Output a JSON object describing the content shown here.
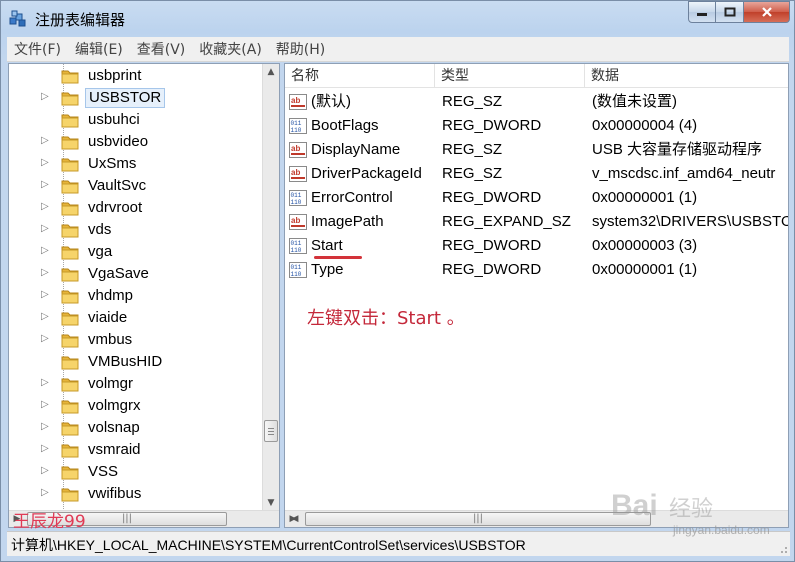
{
  "window": {
    "title": "注册表编辑器",
    "minimize_glyph": "▁",
    "maximize_glyph": "▢",
    "close_glyph": "✕"
  },
  "menu": [
    "文件(F)",
    "编辑(E)",
    "查看(V)",
    "收藏夹(A)",
    "帮助(H)"
  ],
  "tree": {
    "items": [
      {
        "label": "usbprint",
        "expandable": false
      },
      {
        "label": "USBSTOR",
        "expandable": true,
        "selected": true
      },
      {
        "label": "usbuhci",
        "expandable": false
      },
      {
        "label": "usbvideo",
        "expandable": true
      },
      {
        "label": "UxSms",
        "expandable": true
      },
      {
        "label": "VaultSvc",
        "expandable": true
      },
      {
        "label": "vdrvroot",
        "expandable": true
      },
      {
        "label": "vds",
        "expandable": true
      },
      {
        "label": "vga",
        "expandable": true
      },
      {
        "label": "VgaSave",
        "expandable": true
      },
      {
        "label": "vhdmp",
        "expandable": true
      },
      {
        "label": "viaide",
        "expandable": true
      },
      {
        "label": "vmbus",
        "expandable": true
      },
      {
        "label": "VMBusHID",
        "expandable": false
      },
      {
        "label": "volmgr",
        "expandable": true
      },
      {
        "label": "volmgrx",
        "expandable": true
      },
      {
        "label": "volsnap",
        "expandable": true
      },
      {
        "label": "vsmraid",
        "expandable": true
      },
      {
        "label": "VSS",
        "expandable": true
      },
      {
        "label": "vwifibus",
        "expandable": true
      }
    ]
  },
  "list": {
    "headers": {
      "name": "名称",
      "type": "类型",
      "data": "数据"
    },
    "rows": [
      {
        "icon": "string-value-icon",
        "name": "(默认)",
        "type": "REG_SZ",
        "data": "(数值未设置)"
      },
      {
        "icon": "binary-value-icon",
        "name": "BootFlags",
        "type": "REG_DWORD",
        "data": "0x00000004 (4)"
      },
      {
        "icon": "string-value-icon",
        "name": "DisplayName",
        "type": "REG_SZ",
        "data": "USB 大容量存储驱动程序"
      },
      {
        "icon": "string-value-icon",
        "name": "DriverPackageId",
        "type": "REG_SZ",
        "data": "v_mscdsc.inf_amd64_neutr"
      },
      {
        "icon": "binary-value-icon",
        "name": "ErrorControl",
        "type": "REG_DWORD",
        "data": "0x00000001 (1)"
      },
      {
        "icon": "string-value-icon",
        "name": "ImagePath",
        "type": "REG_EXPAND_SZ",
        "data": "system32\\DRIVERS\\USBSTO"
      },
      {
        "icon": "binary-value-icon",
        "name": "Start",
        "type": "REG_DWORD",
        "data": "0x00000003 (3)"
      },
      {
        "icon": "binary-value-icon",
        "name": "Type",
        "type": "REG_DWORD",
        "data": "0x00000001 (1)"
      }
    ],
    "annotation": "左键双击：Start 。",
    "highlight_color": "#d3333a"
  },
  "status": {
    "path": "计算机\\HKEY_LOCAL_MACHINE\\SYSTEM\\CurrentControlSet\\services\\USBSTOR"
  },
  "watermarks": {
    "author": "王辰龙99",
    "baidu": "Bai",
    "baidu_sub": "经验",
    "url": "jingyan.baidu.com"
  },
  "scroll": {
    "up": "▲",
    "down": "▼",
    "left": "◀",
    "right": "▶",
    "grip": "|||"
  }
}
